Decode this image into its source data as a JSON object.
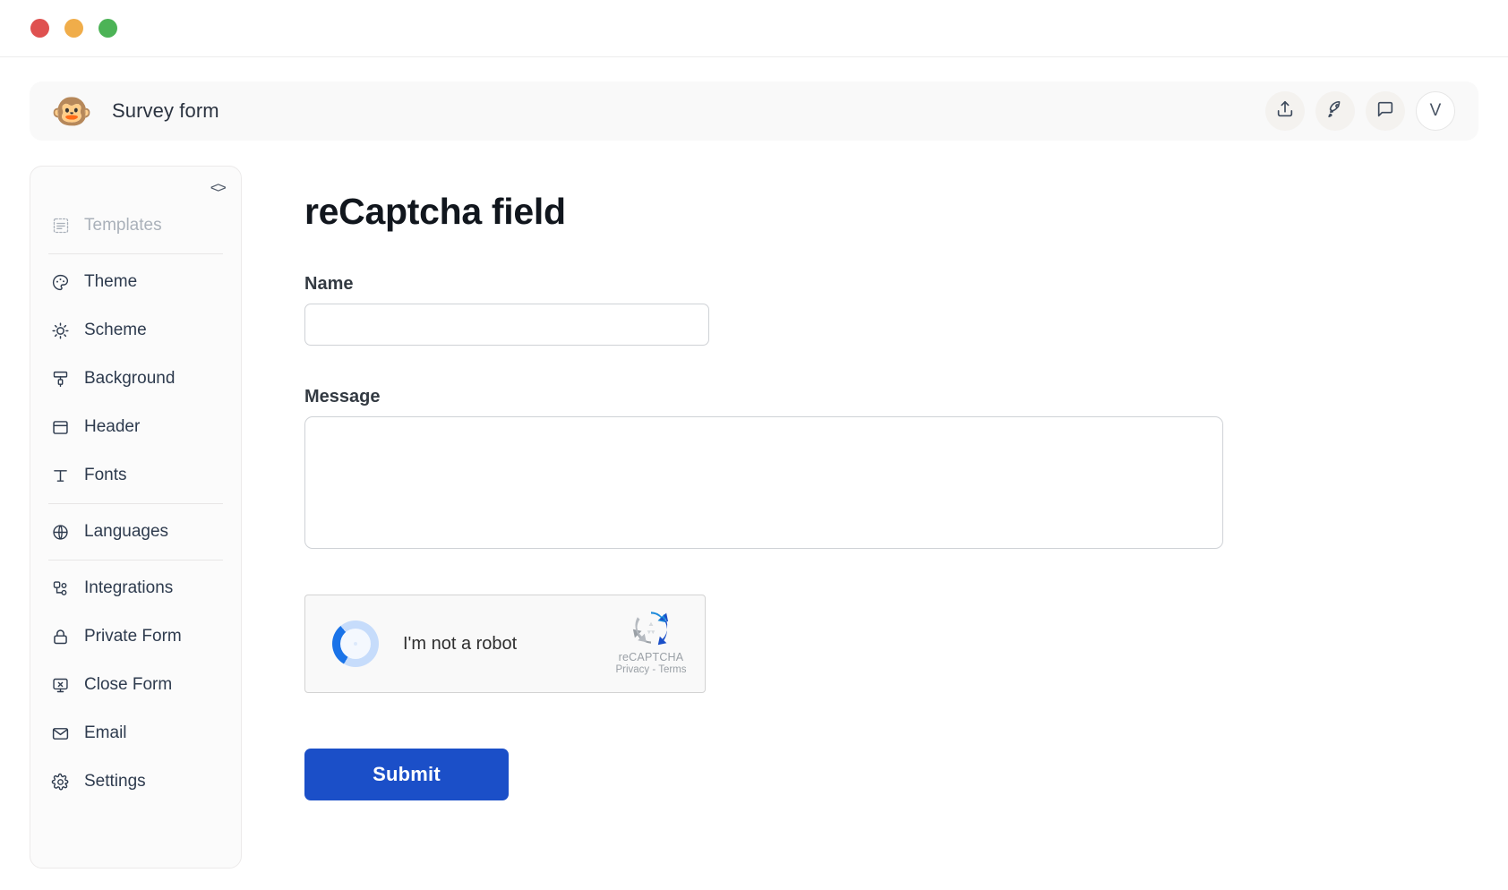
{
  "window": {
    "controls": [
      {
        "name": "close",
        "color": "#df5150"
      },
      {
        "name": "minimize",
        "color": "#f0ad4a"
      },
      {
        "name": "maximize",
        "color": "#4cb356"
      }
    ]
  },
  "header": {
    "logo_glyph": "🐵",
    "title": "Survey form",
    "actions": [
      {
        "id": "share",
        "icon": "upload-icon"
      },
      {
        "id": "publish",
        "icon": "rocket-icon"
      },
      {
        "id": "messages",
        "icon": "chat-bubble-icon"
      }
    ],
    "avatar_initial": "V"
  },
  "sidebar": {
    "code_toggle": "<>",
    "items": [
      {
        "label": "Templates",
        "icon": "templates-icon",
        "disabled": true
      },
      {
        "label": "Theme",
        "icon": "palette-icon",
        "disabled": false
      },
      {
        "label": "Scheme",
        "icon": "brightness-icon",
        "disabled": false
      },
      {
        "label": "Background",
        "icon": "paint-roller-icon",
        "disabled": false
      },
      {
        "label": "Header",
        "icon": "layout-icon",
        "disabled": false
      },
      {
        "label": "Fonts",
        "icon": "text-type-icon",
        "disabled": false
      },
      {
        "label": "Languages",
        "icon": "globe-icon",
        "disabled": false
      },
      {
        "label": "Integrations",
        "icon": "nodes-icon",
        "disabled": false
      },
      {
        "label": "Private Form",
        "icon": "lock-icon",
        "disabled": false
      },
      {
        "label": "Close Form",
        "icon": "monitor-x-icon",
        "disabled": false
      },
      {
        "label": "Email",
        "icon": "envelope-icon",
        "disabled": false
      },
      {
        "label": "Settings",
        "icon": "gear-icon",
        "disabled": false
      }
    ]
  },
  "main": {
    "title": "reCaptcha field",
    "fields": {
      "name": {
        "label": "Name",
        "value": "",
        "placeholder": ""
      },
      "message": {
        "label": "Message",
        "value": "",
        "placeholder": ""
      }
    },
    "recaptcha": {
      "checkbox_label": "I'm not a robot",
      "brand": "reCAPTCHA",
      "terms": "Privacy - Terms",
      "state": "loading"
    },
    "submit_label": "Submit"
  },
  "colors": {
    "accent": "#1b4fc8",
    "sidebar_bg": "#fbfbfb",
    "header_bg": "#f9f9f9",
    "recaptcha_blue": "#1a73e8"
  }
}
